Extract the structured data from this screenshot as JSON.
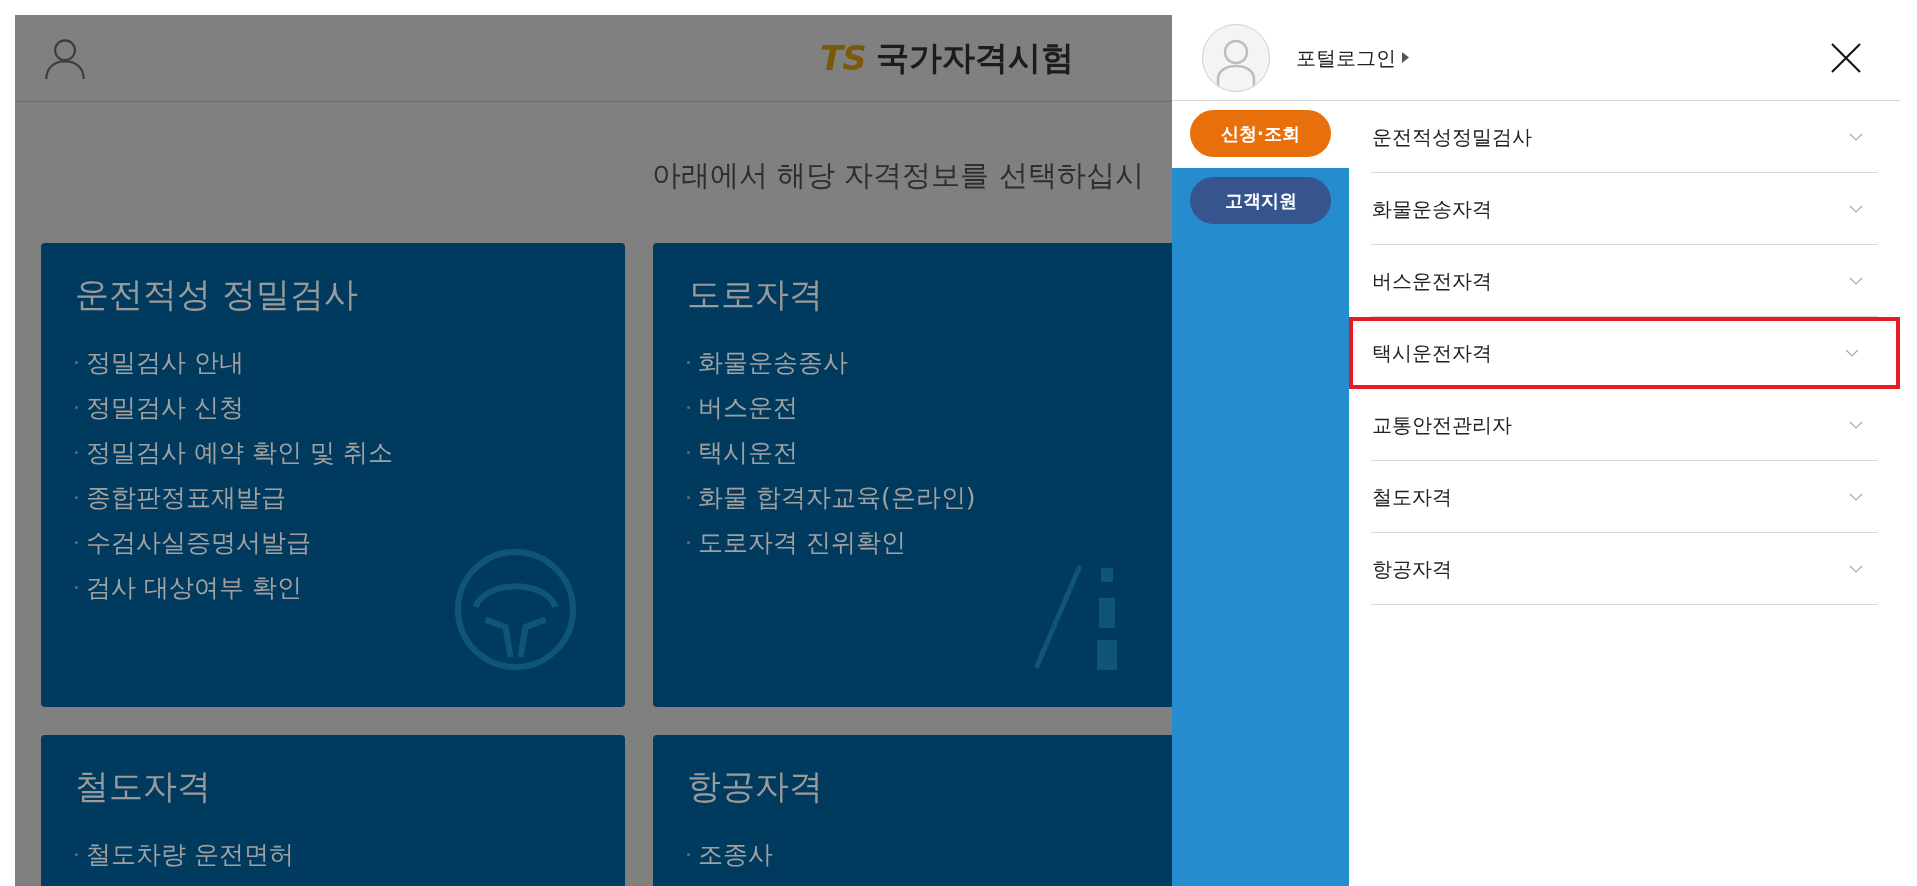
{
  "header": {
    "logo_mark": "TS",
    "title": "국가자격시험"
  },
  "subtitle": "아래에서 해당 자격정보를 선택하십시",
  "cards": [
    {
      "title": "운전적성 정밀검사",
      "links": [
        "정밀검사 안내",
        "정밀검사 신청",
        "정밀검사 예약 확인 및 취소",
        "종합판정표재발급",
        "수검사실증명서발급",
        "검사 대상여부 확인"
      ]
    },
    {
      "title": "도로자격",
      "links": [
        "화물운송종사",
        "버스운전",
        "택시운전",
        "화물 합격자교육(온라인)",
        "도로자격 진위확인"
      ]
    },
    {
      "title": "철도자격",
      "links": [
        "철도차량 운전면허"
      ]
    },
    {
      "title": "항공자격",
      "links": [
        "조종사"
      ]
    }
  ],
  "menu_panel": {
    "login_link": "포털로그인",
    "tabs": [
      {
        "label": "신청·조회",
        "selected": true
      },
      {
        "label": "고객지원",
        "selected": false
      }
    ],
    "items": [
      {
        "label": "운전적성정밀검사",
        "highlighted": false
      },
      {
        "label": "화물운송자격",
        "highlighted": false
      },
      {
        "label": "버스운전자격",
        "highlighted": false
      },
      {
        "label": "택시운전자격",
        "highlighted": true
      },
      {
        "label": "교통안전관리자",
        "highlighted": false
      },
      {
        "label": "철도자격",
        "highlighted": false
      },
      {
        "label": "항공자격",
        "highlighted": false
      }
    ]
  }
}
